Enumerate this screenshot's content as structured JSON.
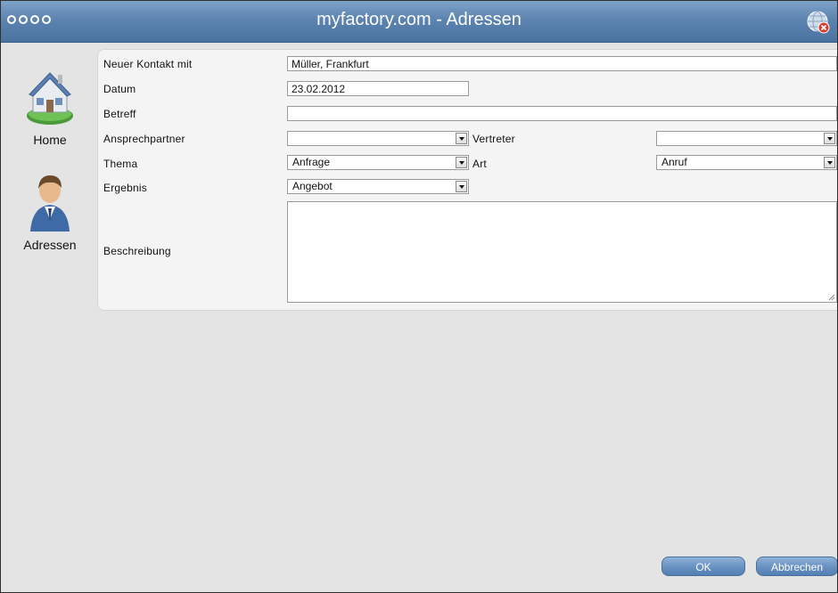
{
  "window": {
    "title": "myfactory.com - Adressen"
  },
  "sidebar": {
    "items": [
      {
        "label": "Home",
        "icon": "house-icon"
      },
      {
        "label": "Adressen",
        "icon": "person-icon"
      }
    ]
  },
  "form": {
    "neuer_kontakt": {
      "label": "Neuer Kontakt mit",
      "value": "Müller, Frankfurt"
    },
    "datum": {
      "label": "Datum",
      "value": "23.02.2012"
    },
    "betreff": {
      "label": "Betreff",
      "value": ""
    },
    "ansprechpartner": {
      "label": "Ansprechpartner",
      "value": ""
    },
    "vertreter": {
      "label": "Vertreter",
      "value": ""
    },
    "thema": {
      "label": "Thema",
      "value": "Anfrage"
    },
    "art": {
      "label": "Art",
      "value": "Anruf"
    },
    "ergebnis": {
      "label": "Ergebnis",
      "value": "Angebot"
    },
    "beschreibung": {
      "label": "Beschreibung",
      "value": ""
    }
  },
  "buttons": {
    "ok": "OK",
    "cancel": "Abbrechen"
  },
  "colors": {
    "titlebar": "#5d84b0",
    "button": "#6a93c2",
    "background": "#e4e4e4"
  }
}
